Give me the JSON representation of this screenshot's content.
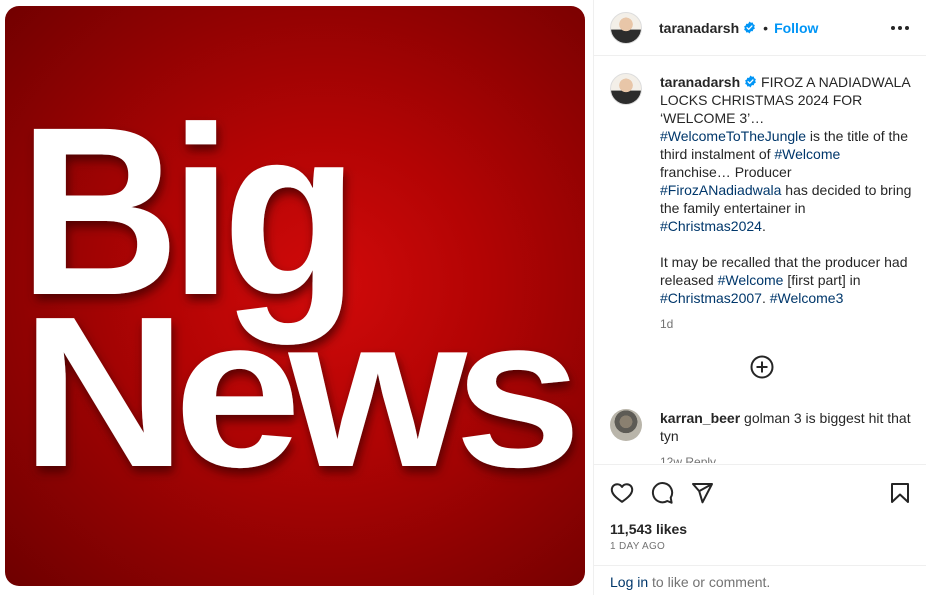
{
  "media": {
    "line1": "Big",
    "line2": "News"
  },
  "post": {
    "username": "taranadarsh",
    "follow_label": "Follow",
    "dot": "•"
  },
  "caption": {
    "username": "taranadarsh",
    "p1_t1": " FIROZ A NADIADWALA LOCKS CHRISTMAS 2024 FOR ‘WELCOME 3’… ",
    "p1_h1": "#WelcomeToTheJungle",
    "p1_t2": " is the title of the third instalment of ",
    "p1_h2": "#Welcome",
    "p1_t3": " franchise… Producer ",
    "p1_h3": "#FirozANadiadwala",
    "p1_t4": " has decided to bring the family entertainer in ",
    "p1_h4": "#Christmas2024",
    "p1_t5": ".",
    "p2_t1": "It may be recalled that the producer had released ",
    "p2_h1": "#Welcome",
    "p2_t2": " [first part] in ",
    "p2_h2": "#Christmas2007",
    "p2_t3": ". ",
    "p2_h3": "#Welcome3",
    "time": "1d"
  },
  "comment": {
    "username": "karran_beer",
    "text": " golman 3 is biggest hit that tyn",
    "meta": "12w  Reply"
  },
  "actions": {
    "likes": "11,543 likes",
    "ago": "1 DAY AGO",
    "login_link": "Log in",
    "login_rest": " to like or comment."
  },
  "colors": {
    "link_blue": "#0095f6",
    "hashtag": "#00376b",
    "media_red": "#b30404"
  },
  "icons": [
    "verified-badge-icon",
    "more-options-icon",
    "load-more-plus-icon",
    "heart-icon",
    "comment-icon",
    "share-icon",
    "bookmark-icon"
  ]
}
